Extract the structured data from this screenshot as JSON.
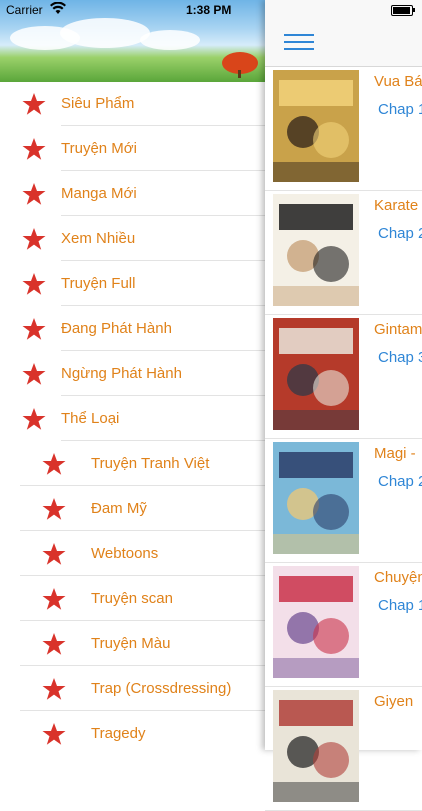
{
  "status_bar": {
    "carrier": "Carrier",
    "time": "1:38 PM"
  },
  "menu": {
    "items": [
      {
        "label": "Siêu Phẩm",
        "indent": false
      },
      {
        "label": "Truyện Mới",
        "indent": false
      },
      {
        "label": "Manga Mới",
        "indent": false
      },
      {
        "label": "Xem Nhiều",
        "indent": false
      },
      {
        "label": "Truyện Full",
        "indent": false
      },
      {
        "label": "Đang Phát Hành",
        "indent": false
      },
      {
        "label": "Ngừng Phát Hành",
        "indent": false
      },
      {
        "label": "Thể Loại",
        "indent": false
      },
      {
        "label": "Truyện Tranh Việt",
        "indent": true
      },
      {
        "label": "Đam Mỹ",
        "indent": true
      },
      {
        "label": "Webtoons",
        "indent": true
      },
      {
        "label": "Truyện scan",
        "indent": true
      },
      {
        "label": "Truyện Màu",
        "indent": true
      },
      {
        "label": "Trap (Crossdressing)",
        "indent": true
      },
      {
        "label": "Tragedy",
        "indent": true
      }
    ]
  },
  "list": {
    "rows": [
      {
        "title": "Vua Bá",
        "chap": "Chap 1",
        "colors": [
          "#c9a24a",
          "#f2d27a",
          "#3a2a1c"
        ]
      },
      {
        "title": "Karate",
        "chap": "Chap 2",
        "colors": [
          "#f4f0e6",
          "#1e1e1e",
          "#c8a37a"
        ]
      },
      {
        "title": "Gintam",
        "chap": "Chap 3",
        "colors": [
          "#b53a2a",
          "#eae6dc",
          "#3a3a46"
        ]
      },
      {
        "title": "Magi -",
        "chap": "Chap 2",
        "colors": [
          "#7bb8d8",
          "#2b3d6a",
          "#e9c77c"
        ]
      },
      {
        "title": "Chuyện",
        "chap": "Chap 1",
        "colors": [
          "#f3dfe9",
          "#c9324a",
          "#7a5a9a"
        ]
      },
      {
        "title": "Giyen",
        "chap": "",
        "colors": [
          "#e9e4d8",
          "#b0403a",
          "#333"
        ]
      }
    ]
  },
  "accent": {
    "orange": "#e0821a",
    "blue": "#2f86d6",
    "star": "#d9332b"
  }
}
